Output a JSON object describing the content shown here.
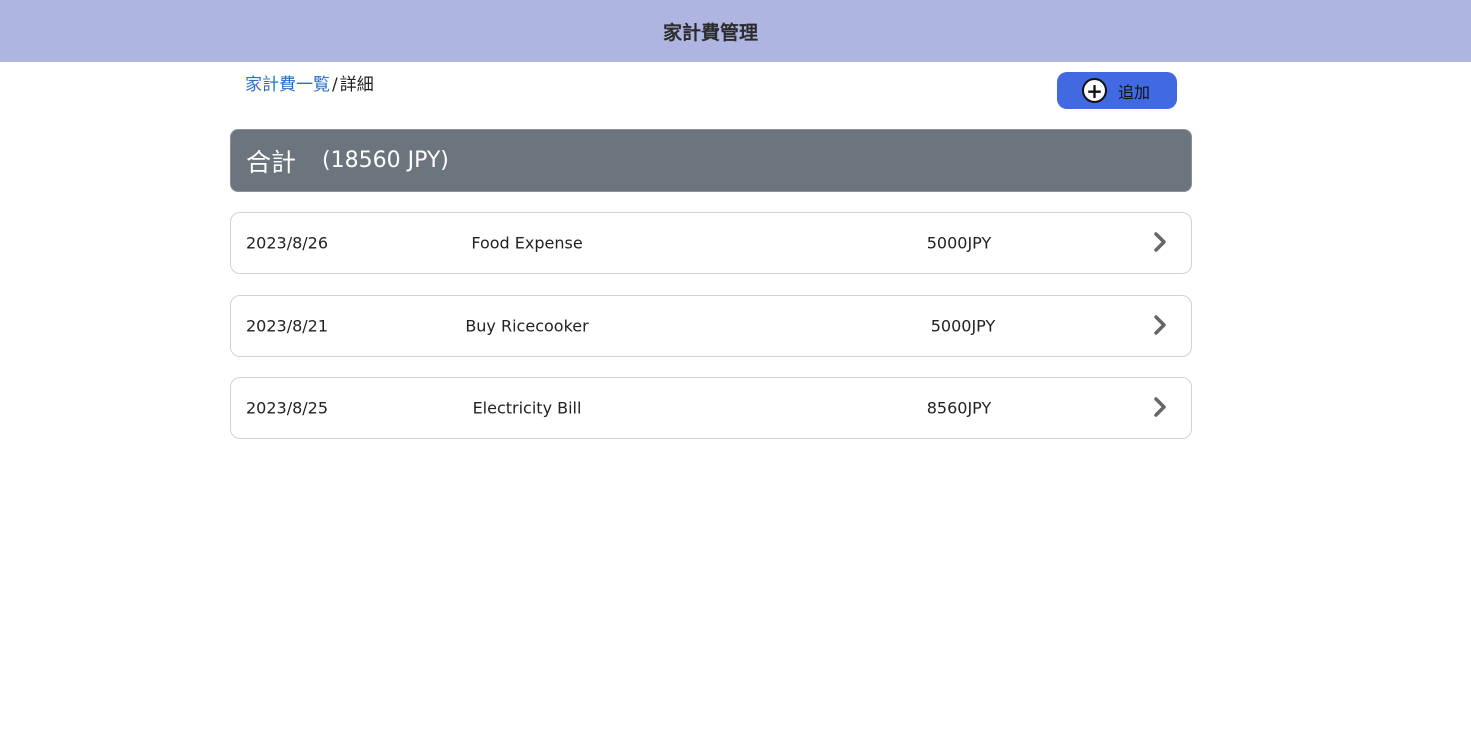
{
  "header": {
    "title": "家計費管理"
  },
  "breadcrumb": {
    "link_label": "家計費一覧",
    "separator": "/",
    "current": "詳細"
  },
  "add_button": {
    "icon": "plus-circle-icon",
    "label": "追加"
  },
  "total": {
    "label": "合計",
    "amount": "(18560 JPY)"
  },
  "items": [
    {
      "date": "2023/8/26",
      "description": "Food Expense",
      "amount": "5000JPY"
    },
    {
      "date": "2023/8/21",
      "description": "Buy Ricecooker",
      "amount": "5000JPY"
    },
    {
      "date": "2023/8/25",
      "description": "Electricity Bill",
      "amount": "8560JPY"
    }
  ],
  "colors": {
    "header_bg": "#afb5e1",
    "button_bg": "#4169e1",
    "total_bg": "#6c757d",
    "link": "#2a6dc9"
  }
}
